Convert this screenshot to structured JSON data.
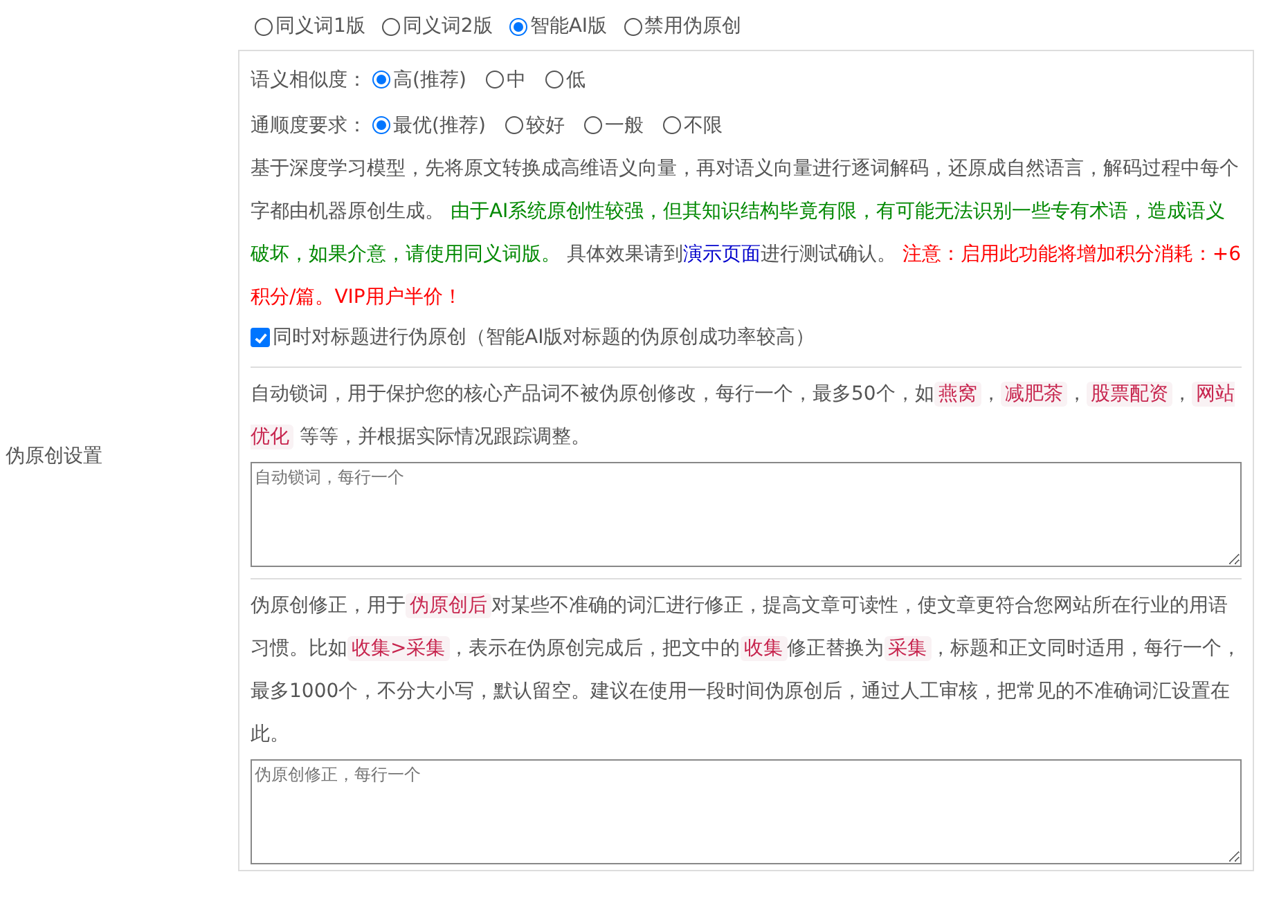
{
  "label": "伪原创设置",
  "modes": [
    {
      "label": "同义词1版",
      "selected": false
    },
    {
      "label": "同义词2版",
      "selected": false
    },
    {
      "label": "智能AI版",
      "selected": true
    },
    {
      "label": "禁用伪原创",
      "selected": false
    }
  ],
  "similarity": {
    "label": "语义相似度：",
    "options": [
      {
        "label": "高(推荐)",
        "selected": true
      },
      {
        "label": "中",
        "selected": false
      },
      {
        "label": "低",
        "selected": false
      }
    ]
  },
  "fluency": {
    "label": "通顺度要求：",
    "options": [
      {
        "label": "最优(推荐)",
        "selected": true
      },
      {
        "label": "较好",
        "selected": false
      },
      {
        "label": "一般",
        "selected": false
      },
      {
        "label": "不限",
        "selected": false
      }
    ]
  },
  "ai_description": [
    {
      "kind": "plain",
      "text": "基于深度学习模型，先将原文转换成高维语义向量，再对语义向量进行逐词解码，还原成自然语言，解码过程中每个字都由机器原创生成。 "
    },
    {
      "kind": "green",
      "text": "由于AI系统原创性较强，但其知识结构毕竟有限，有可能无法识别一些专有术语，造成语义破坏，如果介意，请使用同义词版。"
    },
    {
      "kind": "plain",
      "text": " 具体效果请到"
    },
    {
      "kind": "link",
      "text": "演示页面"
    },
    {
      "kind": "plain",
      "text": "进行测试确认。 "
    },
    {
      "kind": "red",
      "text": "注意：启用此功能将增加积分消耗：+6积分/篇。VIP用户半价！"
    }
  ],
  "title_option": {
    "label": "同时对标题进行伪原创（智能AI版对标题的伪原创成功率较高）",
    "checked": true
  },
  "lock_words": {
    "description": [
      {
        "kind": "plain",
        "text": "自动锁词，用于保护您的核心产品词不被伪原创修改，每行一个，最多50个，如"
      },
      {
        "kind": "tag",
        "text": "燕窝"
      },
      {
        "kind": "plain",
        "text": "，"
      },
      {
        "kind": "tag",
        "text": "减肥茶"
      },
      {
        "kind": "plain",
        "text": "，"
      },
      {
        "kind": "tag",
        "text": "股票配资"
      },
      {
        "kind": "plain",
        "text": "，"
      },
      {
        "kind": "tag",
        "text": "网站优化"
      },
      {
        "kind": "plain",
        "text": " 等等，并根据实际情况跟踪调整。"
      }
    ],
    "placeholder": "自动锁词，每行一个"
  },
  "corrections": {
    "description": [
      {
        "kind": "plain",
        "text": "伪原创修正，用于"
      },
      {
        "kind": "tag",
        "text": "伪原创后"
      },
      {
        "kind": "plain",
        "text": "对某些不准确的词汇进行修正，提高文章可读性，使文章更符合您网站所在行业的用语习惯。比如"
      },
      {
        "kind": "tag",
        "text": "收集>采集"
      },
      {
        "kind": "plain",
        "text": "，表示在伪原创完成后，把文中的"
      },
      {
        "kind": "tag",
        "text": "收集"
      },
      {
        "kind": "plain",
        "text": "修正替换为"
      },
      {
        "kind": "tag",
        "text": "采集"
      },
      {
        "kind": "plain",
        "text": "，标题和正文同时适用，每行一个，最多1000个，不分大小写，默认留空。建议在使用一段时间伪原创后，通过人工审核，把常见的不准确词汇设置在此。"
      }
    ],
    "placeholder": "伪原创修正，每行一个"
  }
}
